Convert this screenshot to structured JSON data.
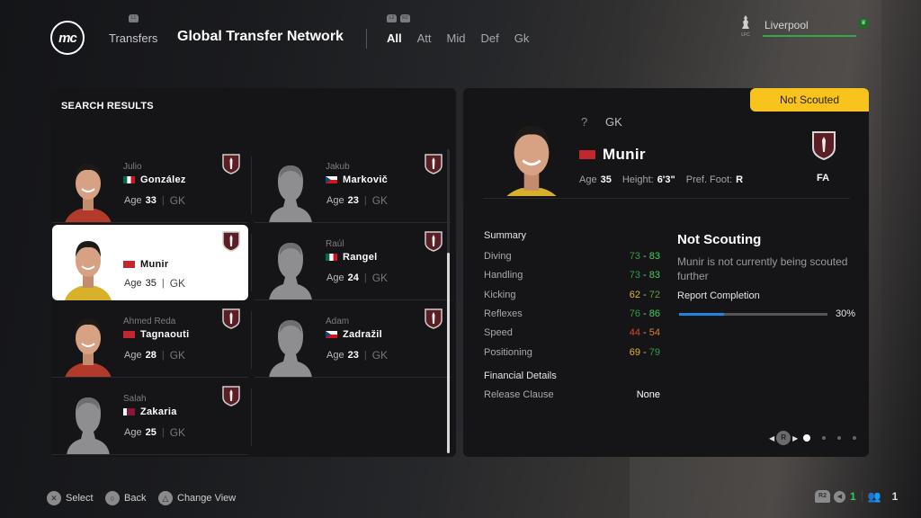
{
  "header": {
    "logo_text": "mc",
    "lb_hint": "L1",
    "section": "Transfers",
    "title": "Global Transfer Network",
    "tab_hints": [
      "L2",
      "R2"
    ],
    "filters": [
      {
        "label": "All",
        "active": true
      },
      {
        "label": "Att",
        "active": false
      },
      {
        "label": "Mid",
        "active": false
      },
      {
        "label": "Def",
        "active": false
      },
      {
        "label": "Gk",
        "active": false
      }
    ],
    "club": {
      "crest_text": "LFC",
      "name": "Liverpool",
      "progress": 0.85,
      "badge_icon": "crown-icon"
    }
  },
  "search": {
    "title": "SEARCH RESULTS",
    "scroll": {
      "position": 0.34,
      "visible_fraction": 0.66
    },
    "players": [
      {
        "first": "Julio",
        "last": "González",
        "flag": "mexico",
        "age_label": "Age",
        "age": "33",
        "pos": "GK",
        "photo": "real",
        "selected": false
      },
      {
        "first": "Jakub",
        "last": "Markovič",
        "flag": "czech",
        "age_label": "Age",
        "age": "23",
        "pos": "GK",
        "photo": "silhouette",
        "selected": false
      },
      {
        "first": "",
        "last": "Munir",
        "flag": "morocco",
        "age_label": "Age",
        "age": "35",
        "pos": "GK",
        "photo": "real",
        "selected": true
      },
      {
        "first": "Raúl",
        "last": "Rangel",
        "flag": "mexico",
        "age_label": "Age",
        "age": "24",
        "pos": "GK",
        "photo": "silhouette",
        "selected": false
      },
      {
        "first": "Ahmed Reda",
        "last": "Tagnaouti",
        "flag": "morocco",
        "age_label": "Age",
        "age": "28",
        "pos": "GK",
        "photo": "real",
        "selected": false
      },
      {
        "first": "Adam",
        "last": "Zadražil",
        "flag": "czech",
        "age_label": "Age",
        "age": "23",
        "pos": "GK",
        "photo": "silhouette",
        "selected": false
      },
      {
        "first": "Salah",
        "last": "Zakaria",
        "flag": "qatar",
        "age_label": "Age",
        "age": "25",
        "pos": "GK",
        "photo": "silhouette",
        "selected": false
      }
    ]
  },
  "detail": {
    "status": "Not Scouted",
    "unknown": "?",
    "position": "GK",
    "name": "Munir",
    "flag": "morocco",
    "age_label": "Age",
    "age": "35",
    "height_label": "Height:",
    "height": "6'3\"",
    "foot_label": "Pref. Foot:",
    "foot": "R",
    "club": "FA",
    "summary_title": "Summary",
    "attributes": [
      {
        "name": "Diving",
        "low": "73",
        "high": "83",
        "low_color": "#2f9e44",
        "high_color": "#3ecf5a"
      },
      {
        "name": "Handling",
        "low": "73",
        "high": "83",
        "low_color": "#2f9e44",
        "high_color": "#3ecf5a"
      },
      {
        "name": "Kicking",
        "low": "62",
        "high": "72",
        "low_color": "#e8b43a",
        "high_color": "#5e9e3a"
      },
      {
        "name": "Reflexes",
        "low": "76",
        "high": "86",
        "low_color": "#2f9e44",
        "high_color": "#3ecf5a"
      },
      {
        "name": "Speed",
        "low": "44",
        "high": "54",
        "low_color": "#e0452f",
        "high_color": "#e07a2f"
      },
      {
        "name": "Positioning",
        "low": "69",
        "high": "79",
        "low_color": "#e8b43a",
        "high_color": "#2f9e44"
      }
    ],
    "financial_title": "Financial Details",
    "release_label": "Release Clause",
    "release_value": "None",
    "scouting_title": "Not Scouting",
    "scouting_desc": "Munir is not currently being scouted further",
    "report_label": "Report Completion",
    "report_pct": 30,
    "report_pct_text": "30%",
    "pager": {
      "button": "R",
      "pages": 4,
      "current": 0
    }
  },
  "footer": {
    "actions": [
      {
        "icon": "cross-button-icon",
        "glyph": "✕",
        "label": "Select"
      },
      {
        "icon": "circle-button-icon",
        "glyph": "○",
        "label": "Back"
      },
      {
        "icon": "triangle-button-icon",
        "glyph": "△",
        "label": "Change View"
      }
    ],
    "r2_label": "R2",
    "mic_count": "1",
    "users_count": "1"
  },
  "colors": {
    "accent_yellow": "#f7c31c",
    "progress_blue": "#1e86e0",
    "club_green": "#36a84a"
  }
}
